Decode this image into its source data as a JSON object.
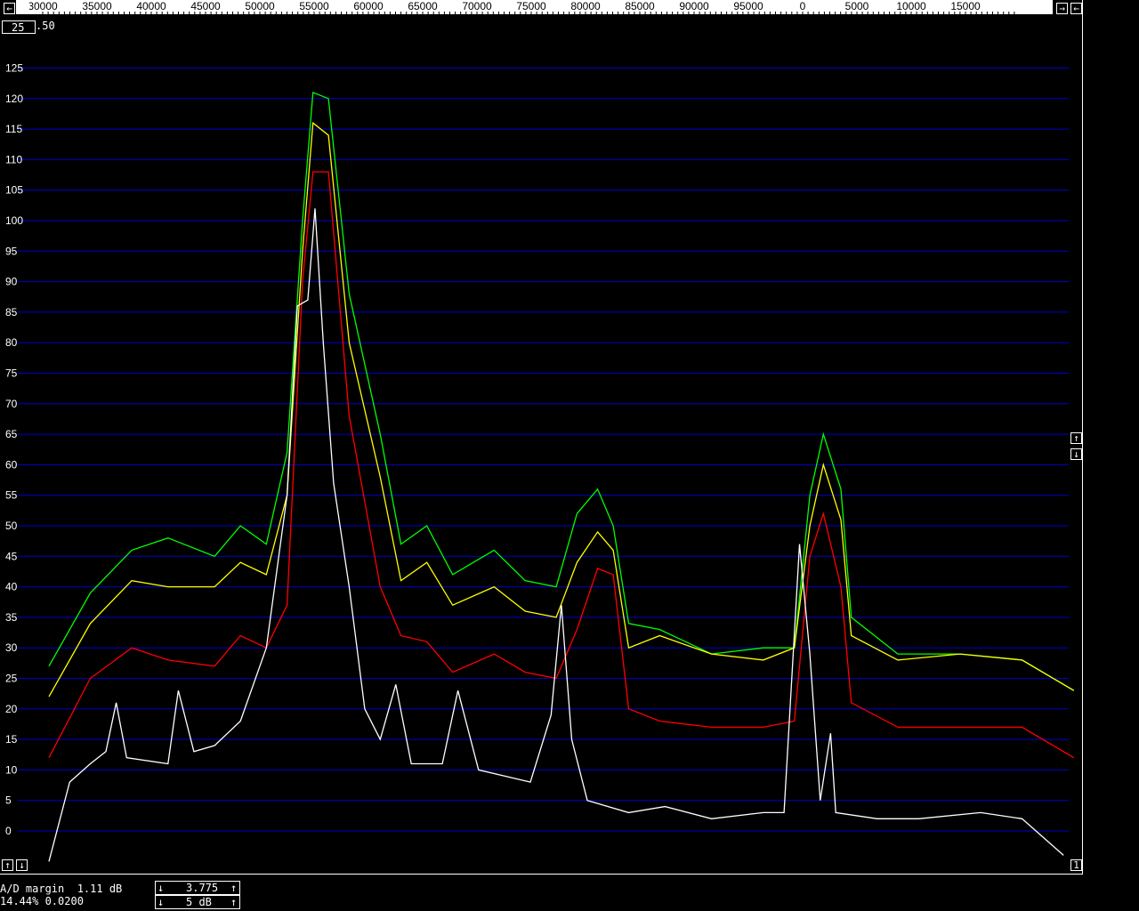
{
  "window": {
    "colors": {
      "background": "#000000",
      "grid": "#0000cc",
      "text": "#ffffff"
    }
  },
  "freq_scale": {
    "ticks": [
      "30000",
      "35000",
      "40000",
      "45000",
      "50000",
      "55000",
      "60000",
      "65000",
      "70000",
      "75000",
      "80000",
      "85000",
      "90000",
      "95000",
      "0",
      "5000",
      "10000",
      "15000"
    ]
  },
  "top_left_field": {
    "value": "25",
    "suffix": ".50"
  },
  "db_scale": {
    "ticks": [
      "125",
      "120",
      "115",
      "110",
      "105",
      "100",
      "95",
      "90",
      "85",
      "80",
      "75",
      "70",
      "65",
      "60",
      "55",
      "50",
      "45",
      "40",
      "35",
      "30",
      "25",
      "20",
      "15",
      "10",
      "5",
      "0"
    ]
  },
  "status": {
    "ad_margin": "A/D margin  1.11 dB",
    "percent": "14.44% 0.0200",
    "gain_value": "3.775",
    "range_value": "5 dB",
    "page_number": "1"
  },
  "icons": {
    "left_arrow": "←",
    "right_arrow": "→",
    "up_arrow": "↑",
    "down_arrow": "↓"
  },
  "chart_data": {
    "type": "line",
    "x_unit": "Hz",
    "ylim": [
      0,
      125
    ],
    "grid": true,
    "series": [
      {
        "color": "#00ff00",
        "points": [
          [
            26000,
            27
          ],
          [
            30000,
            39
          ],
          [
            34000,
            46
          ],
          [
            37500,
            48
          ],
          [
            42000,
            45
          ],
          [
            44500,
            50
          ],
          [
            47000,
            47
          ],
          [
            49000,
            62
          ],
          [
            50500,
            100
          ],
          [
            51500,
            121
          ],
          [
            53000,
            120
          ],
          [
            55000,
            88
          ],
          [
            58000,
            65
          ],
          [
            60000,
            47
          ],
          [
            62500,
            50
          ],
          [
            65000,
            42
          ],
          [
            69000,
            46
          ],
          [
            72000,
            41
          ],
          [
            75000,
            40
          ],
          [
            77000,
            52
          ],
          [
            79000,
            56
          ],
          [
            80500,
            50
          ],
          [
            82000,
            34
          ],
          [
            85000,
            33
          ],
          [
            90000,
            29
          ],
          [
            95000,
            30
          ],
          [
            98000,
            30
          ],
          [
            99500,
            55
          ],
          [
            100800,
            65
          ],
          [
            102500,
            56
          ],
          [
            103500,
            35
          ],
          [
            108000,
            29
          ],
          [
            114000,
            29
          ],
          [
            120000,
            28
          ],
          [
            125000,
            23
          ]
        ]
      },
      {
        "color": "#ffff00",
        "points": [
          [
            26000,
            22
          ],
          [
            30000,
            34
          ],
          [
            34000,
            41
          ],
          [
            37500,
            40
          ],
          [
            42000,
            40
          ],
          [
            44500,
            44
          ],
          [
            47000,
            42
          ],
          [
            49000,
            55
          ],
          [
            50500,
            95
          ],
          [
            51500,
            116
          ],
          [
            53000,
            114
          ],
          [
            55000,
            80
          ],
          [
            58000,
            58
          ],
          [
            60000,
            41
          ],
          [
            62500,
            44
          ],
          [
            65000,
            37
          ],
          [
            69000,
            40
          ],
          [
            72000,
            36
          ],
          [
            75000,
            35
          ],
          [
            77000,
            44
          ],
          [
            79000,
            49
          ],
          [
            80500,
            46
          ],
          [
            82000,
            30
          ],
          [
            85000,
            32
          ],
          [
            90000,
            29
          ],
          [
            95000,
            28
          ],
          [
            98000,
            30
          ],
          [
            99500,
            50
          ],
          [
            100800,
            60
          ],
          [
            102500,
            51
          ],
          [
            103500,
            32
          ],
          [
            108000,
            28
          ],
          [
            114000,
            29
          ],
          [
            120000,
            28
          ],
          [
            125000,
            23
          ]
        ]
      },
      {
        "color": "#ff0000",
        "points": [
          [
            26000,
            12
          ],
          [
            30000,
            25
          ],
          [
            34000,
            30
          ],
          [
            37500,
            28
          ],
          [
            42000,
            27
          ],
          [
            44500,
            32
          ],
          [
            47000,
            30
          ],
          [
            49000,
            37
          ],
          [
            50500,
            90
          ],
          [
            51500,
            108
          ],
          [
            53000,
            108
          ],
          [
            55000,
            68
          ],
          [
            58000,
            40
          ],
          [
            60000,
            32
          ],
          [
            62500,
            31
          ],
          [
            65000,
            26
          ],
          [
            69000,
            29
          ],
          [
            72000,
            26
          ],
          [
            75000,
            25
          ],
          [
            77000,
            33
          ],
          [
            79000,
            43
          ],
          [
            80500,
            42
          ],
          [
            82000,
            20
          ],
          [
            85000,
            18
          ],
          [
            90000,
            17
          ],
          [
            95000,
            17
          ],
          [
            98000,
            18
          ],
          [
            99500,
            45
          ],
          [
            100800,
            52
          ],
          [
            102500,
            40
          ],
          [
            103500,
            21
          ],
          [
            108000,
            17
          ],
          [
            114000,
            17
          ],
          [
            120000,
            17
          ],
          [
            125000,
            12
          ]
        ]
      },
      {
        "color": "#ffffff",
        "points": [
          [
            26000,
            -5
          ],
          [
            28000,
            8
          ],
          [
            30000,
            11
          ],
          [
            31500,
            13
          ],
          [
            32500,
            21
          ],
          [
            33500,
            12
          ],
          [
            37500,
            11
          ],
          [
            38500,
            23
          ],
          [
            40000,
            13
          ],
          [
            42000,
            14
          ],
          [
            44500,
            18
          ],
          [
            47000,
            30
          ],
          [
            49000,
            55
          ],
          [
            50000,
            86
          ],
          [
            51000,
            87
          ],
          [
            51700,
            102
          ],
          [
            52500,
            80
          ],
          [
            53500,
            57
          ],
          [
            55000,
            40
          ],
          [
            56500,
            20
          ],
          [
            58000,
            15
          ],
          [
            59500,
            24
          ],
          [
            61000,
            11
          ],
          [
            64000,
            11
          ],
          [
            65500,
            23
          ],
          [
            67500,
            10
          ],
          [
            70000,
            9
          ],
          [
            72500,
            8
          ],
          [
            74500,
            19
          ],
          [
            75500,
            37
          ],
          [
            76500,
            15
          ],
          [
            78000,
            5
          ],
          [
            82000,
            3
          ],
          [
            85500,
            4
          ],
          [
            90000,
            2
          ],
          [
            95000,
            3
          ],
          [
            97000,
            3
          ],
          [
            98500,
            47
          ],
          [
            99500,
            29
          ],
          [
            100500,
            5
          ],
          [
            101500,
            16
          ],
          [
            102000,
            3
          ],
          [
            106000,
            2
          ],
          [
            110000,
            2
          ],
          [
            116000,
            3
          ],
          [
            120000,
            2
          ],
          [
            124000,
            -4
          ]
        ]
      }
    ]
  }
}
